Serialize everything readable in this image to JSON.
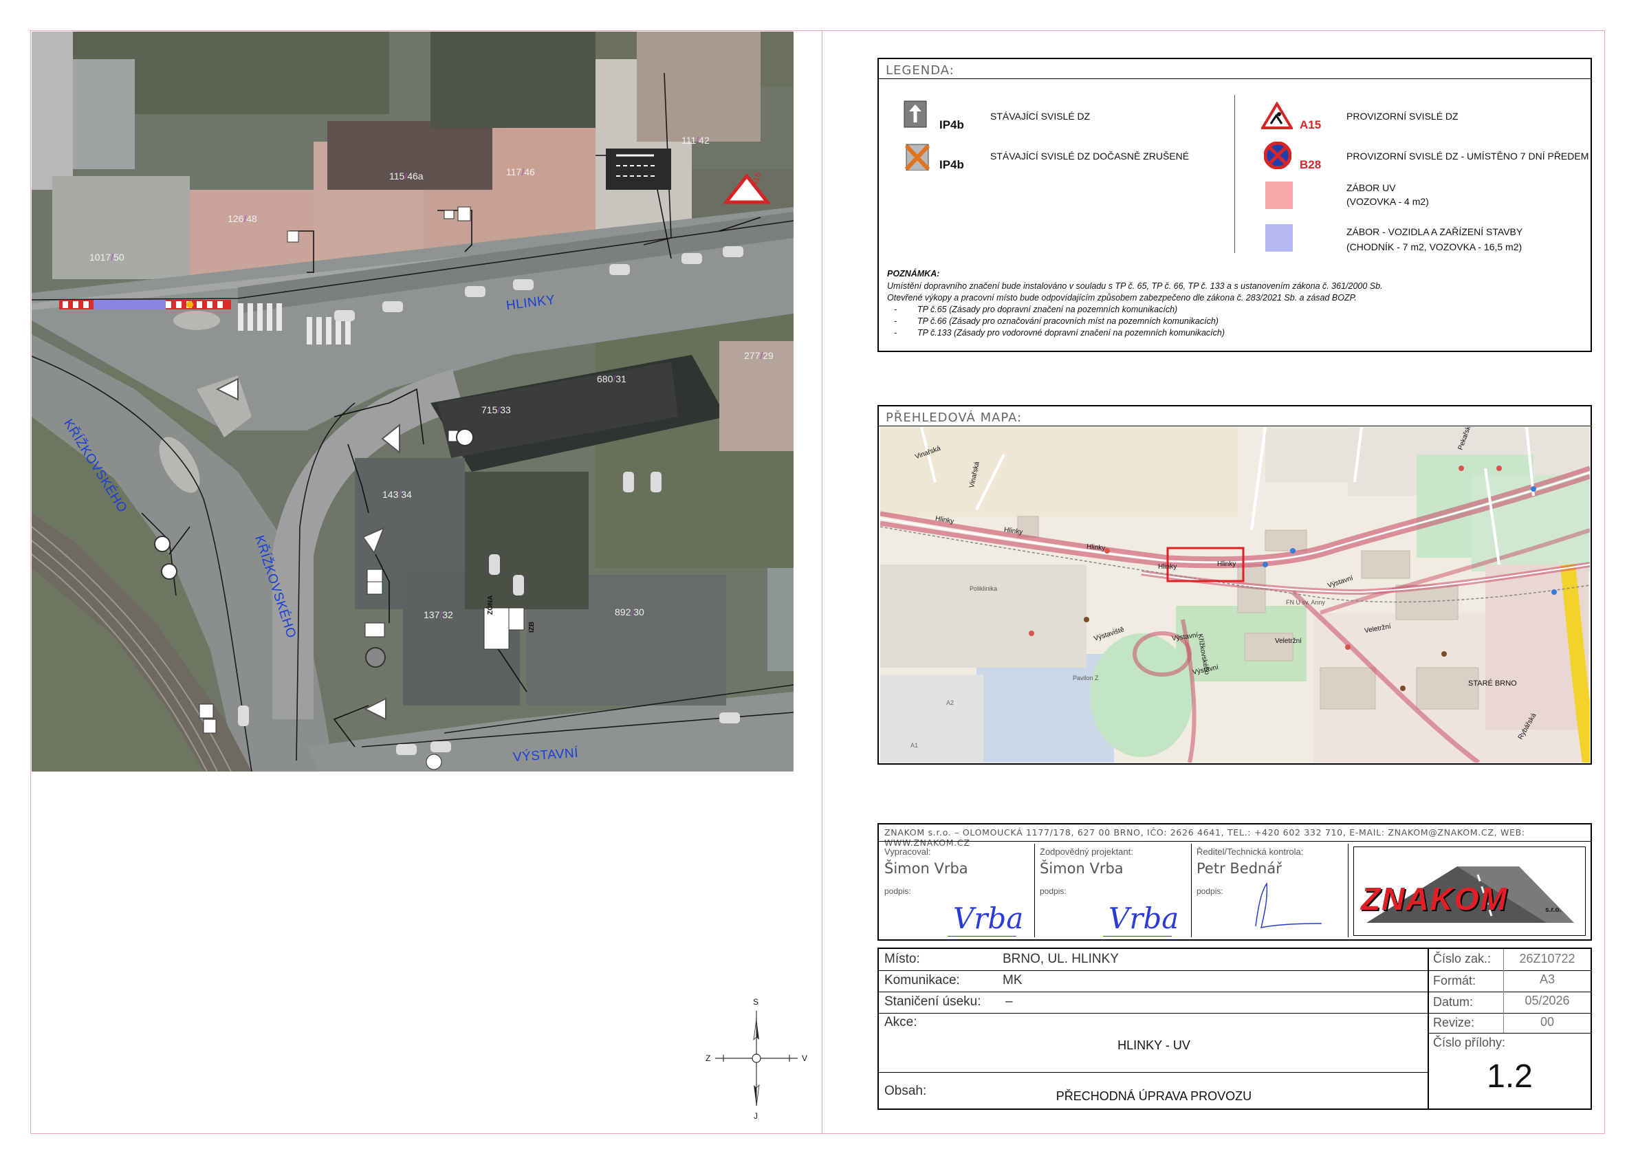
{
  "aerial_map": {
    "streets": {
      "hlinky": "HLINKY",
      "krizkovskeho_1": "KŘÍŽKOVSKÉHO",
      "krizkovskeho_2": "KŘÍŽKOVSKÉHO",
      "vystavni": "VÝSTAVNÍ"
    },
    "house_numbers": [
      {
        "a": "111",
        "b": "42"
      },
      {
        "a": "115",
        "b": "46a"
      },
      {
        "a": "117",
        "b": "46"
      },
      {
        "a": "126",
        "b": "48"
      },
      {
        "a": "1017",
        "b": "50"
      },
      {
        "a": "277",
        "b": "29"
      },
      {
        "a": "680",
        "b": "31"
      },
      {
        "a": "715",
        "b": "33"
      },
      {
        "a": "143",
        "b": "34"
      },
      {
        "a": "137",
        "b": "32"
      },
      {
        "a": "892",
        "b": "30"
      }
    ],
    "sign_labels": {
      "a15": "A15",
      "zone": "ZÓNA",
      "izb": "IZB"
    }
  },
  "legend": {
    "title": "LEGENDA:",
    "items": [
      {
        "code": "IP4b",
        "text": "STÁVAJÍCÍ SVISLÉ DZ",
        "icon": "arrow-up-sign-icon"
      },
      {
        "code": "IP4b",
        "text": "STÁVAJÍCÍ SVISLÉ DZ DOČASNĚ ZRUŠENÉ",
        "icon": "cancelled-sign-icon"
      },
      {
        "code": "A15",
        "text": "PROVIZORNÍ SVISLÉ DZ",
        "icon": "roadwork-warning-icon"
      },
      {
        "code": "B28",
        "text": "PROVIZORNÍ SVISLÉ DZ - UMÍSTĚNO 7 DNÍ PŘEDEM",
        "icon": "no-stopping-icon"
      },
      {
        "code": "",
        "text": "ZÁBOR UV",
        "sub": "(VOZOVKA - 4 m2)",
        "swatch": "#f9a9a9"
      },
      {
        "code": "",
        "text": "ZÁBOR - VOZIDLA A ZAŘÍZENÍ STAVBY",
        "sub": "(CHODNÍK - 7 m2, VOZOVKA - 16,5 m2)",
        "swatch": "#b6b6f2"
      }
    ],
    "note_title": "POZNÁMKA:",
    "notes": [
      "Umístění dopravního značení bude instalováno v souladu s  TP č. 65, TP č. 66, TP č. 133 a s ustanovením zákona č. 361/2000 Sb.",
      "Otevřené výkopy a pracovní místo bude odpovídajícím způsobem zabezpečeno dle zákona č. 283/2021 Sb. a zásad BOZP."
    ],
    "tp_list": [
      "TP č.65 (Zásady pro dopravní značení na pozemních komunikacích)",
      "TP č.66 (Zásady pro označování pracovních míst na pozemních komunikacích)",
      "TP č.133 (Zásady pro vodorovné dopravní značení na pozemních komunikacích)"
    ]
  },
  "overview_map": {
    "title": "PŘEHLEDOVÁ MAPA:",
    "labels": {
      "hlinky_1": "Hlinky",
      "hlinky_2": "Hlinky",
      "hlinky_3": "Hlinky",
      "hlinky_4": "Hlinky",
      "vinarska_1": "Vinařská",
      "vinarska_2": "Vinařská",
      "vystavni_1": "Výstavní",
      "vystavni_2": "Výstavní",
      "vystavni_3": "Výstavní",
      "vystaviste": "Výstaviště",
      "veletrzni_1": "Veletržní",
      "veletrzni_2": "Veletržní",
      "krizkovskeho": "Křížkovského",
      "stare_brno": "STARÉ BRNO",
      "pekarska": "Pekařská",
      "rybarska": "Rybářská",
      "hlinky_east": "Hlinky",
      "poliklinika": "Poliklinika",
      "fn": "FN U sv. Anny",
      "pavilon": "Pavilon Z",
      "a2": "A2",
      "a1": "A1"
    }
  },
  "company": {
    "address": "ZNAKOM s.r.o. – OLOMOUCKÁ 1177/178, 627 00 BRNO, IČO: 2626 4641, TEL.: +420 602 332 710, E-MAIL: ZNAKOM@ZNAKOM.CZ, WEB: WWW.ZNAKOM.CZ",
    "people": [
      {
        "role": "Vypracoval:",
        "name": "Šimon Vrba",
        "podpis": "podpis:"
      },
      {
        "role": "Zodpovědný projektant:",
        "name": "Šimon Vrba",
        "podpis": "podpis:"
      },
      {
        "role": "Ředitel/Technická kontrola:",
        "name": "Petr Bednář",
        "podpis": "podpis:"
      }
    ],
    "signatures": [
      "Vrba",
      "Vrba"
    ],
    "logo_text": "ZNAKOM",
    "logo_sub": "s.r.o."
  },
  "title_block": {
    "misto_label": "Místo:",
    "misto": "BRNO, UL. HLINKY",
    "komunikace_label": "Komunikace:",
    "komunikace": "MK",
    "staniceni_label": "Staničení úseku:",
    "staniceni": "–",
    "akce_label": "Akce:",
    "akce": "HLINKY - UV",
    "obsah_label": "Obsah:",
    "obsah": "PŘECHODNÁ ÚPRAVA PROVOZU",
    "cislo_zak_label": "Číslo zak.:",
    "cislo_zak": "26Z10722",
    "format_label": "Formát:",
    "format": "A3",
    "datum_label": "Datum:",
    "datum": "05/2026",
    "revize_label": "Revize:",
    "revize": "00",
    "cislo_prilohy_label": "Číslo přílohy:",
    "cislo_prilohy": "1.2"
  },
  "compass": {
    "s": "S",
    "j": "J",
    "z": "Z",
    "v": "V"
  },
  "colors": {
    "street_label": "#1b3fd9",
    "sheet_border": "#f2a7b2",
    "zabor_uv": "#f9a9a9",
    "zabor_stavby": "#b6b6f2",
    "logo_red": "#e21f26"
  }
}
